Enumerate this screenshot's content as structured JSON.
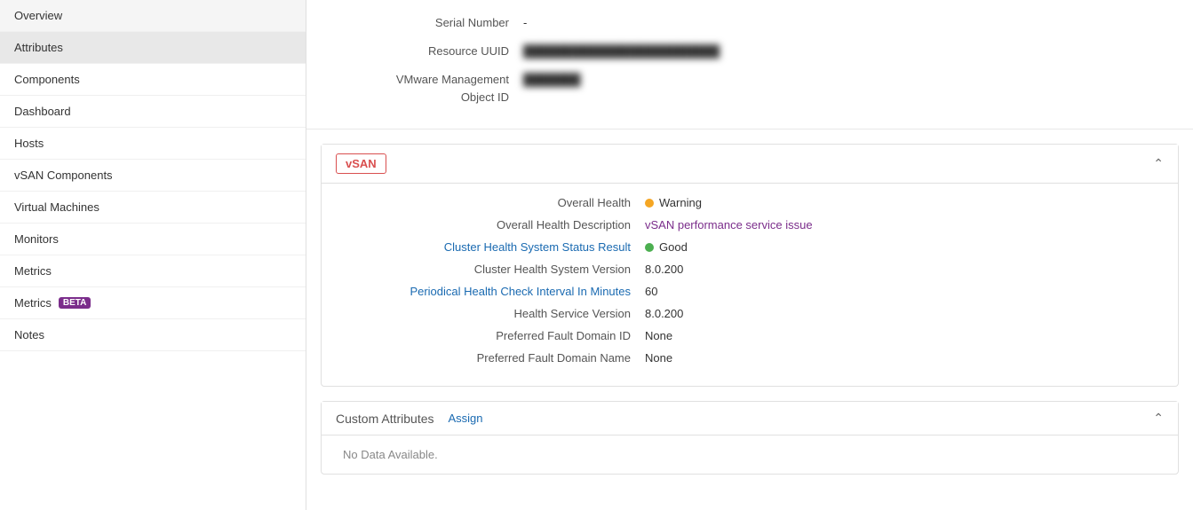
{
  "sidebar": {
    "items": [
      {
        "id": "overview",
        "label": "Overview",
        "active": false,
        "badge": null
      },
      {
        "id": "attributes",
        "label": "Attributes",
        "active": true,
        "badge": null
      },
      {
        "id": "components",
        "label": "Components",
        "active": false,
        "badge": null
      },
      {
        "id": "dashboard",
        "label": "Dashboard",
        "active": false,
        "badge": null
      },
      {
        "id": "hosts",
        "label": "Hosts",
        "active": false,
        "badge": null
      },
      {
        "id": "vsan-components",
        "label": "vSAN Components",
        "active": false,
        "badge": null
      },
      {
        "id": "virtual-machines",
        "label": "Virtual Machines",
        "active": false,
        "badge": null
      },
      {
        "id": "monitors",
        "label": "Monitors",
        "active": false,
        "badge": null
      },
      {
        "id": "metrics",
        "label": "Metrics",
        "active": false,
        "badge": null
      },
      {
        "id": "metrics-beta",
        "label": "Metrics",
        "active": false,
        "badge": "BETA"
      },
      {
        "id": "notes",
        "label": "Notes",
        "active": false,
        "badge": null
      }
    ]
  },
  "top_fields": [
    {
      "id": "serial-number",
      "label": "Serial Number",
      "value": "-",
      "blurred": false
    },
    {
      "id": "resource-uuid",
      "label": "Resource UUID",
      "value": "████████████████████████",
      "blurred": true
    },
    {
      "id": "vmware-mgmt-id",
      "label": "VMware Management Object ID",
      "value": "███████",
      "blurred": true
    }
  ],
  "vsan_section": {
    "title": "vSAN",
    "fields": [
      {
        "id": "overall-health",
        "label": "Overall Health",
        "value": "Warning",
        "status": "warning",
        "link": false
      },
      {
        "id": "overall-health-desc",
        "label": "Overall Health Description",
        "value": "vSAN performance service issue",
        "status": null,
        "link": false
      },
      {
        "id": "cluster-health-status",
        "label": "Cluster Health System Status Result",
        "value": "Good",
        "status": "good",
        "link": true
      },
      {
        "id": "cluster-health-version",
        "label": "Cluster Health System Version",
        "value": "8.0.200",
        "status": null,
        "link": false
      },
      {
        "id": "periodical-health-interval",
        "label": "Periodical Health Check Interval In Minutes",
        "value": "60",
        "status": null,
        "link": true
      },
      {
        "id": "health-service-version",
        "label": "Health Service Version",
        "value": "8.0.200",
        "status": null,
        "link": false
      },
      {
        "id": "preferred-fault-domain-id",
        "label": "Preferred Fault Domain ID",
        "value": "None",
        "status": null,
        "link": false
      },
      {
        "id": "preferred-fault-domain-name",
        "label": "Preferred Fault Domain Name",
        "value": "None",
        "status": null,
        "link": false
      }
    ]
  },
  "custom_attributes": {
    "title": "Custom Attributes",
    "assign_label": "Assign",
    "no_data_label": "No Data Available."
  }
}
